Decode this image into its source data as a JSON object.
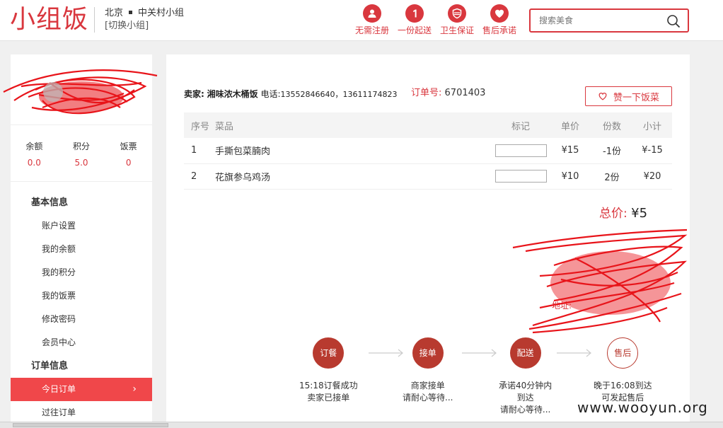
{
  "header": {
    "logo": "小组饭",
    "city": "北京",
    "group": "中关村小组",
    "switch_label": "[切换小组]",
    "features": [
      {
        "icon": "user-icon",
        "label": "无需注册"
      },
      {
        "icon": "number-one-icon",
        "label": "一份起送"
      },
      {
        "icon": "shield-icon",
        "label": "卫生保证"
      },
      {
        "icon": "heart-icon",
        "label": "售后承诺"
      }
    ],
    "search_placeholder": "搜索美食"
  },
  "sidebar": {
    "stats": [
      {
        "label": "余额",
        "value": "0.0"
      },
      {
        "label": "积分",
        "value": "5.0"
      },
      {
        "label": "饭票",
        "value": "0"
      }
    ],
    "basic_info_head": "基本信息",
    "basic_items": [
      "账户设置",
      "我的余额",
      "我的积分",
      "我的饭票",
      "修改密码",
      "会员中心"
    ],
    "order_info_head": "订单信息",
    "order_items": [
      "今日订单",
      "过往订单"
    ],
    "active_chevron": "›"
  },
  "order": {
    "seller_label": "卖家:",
    "seller_name": "湘味浓木桶饭",
    "phone_label": "电话:",
    "phones": "13552846640，13611174823",
    "order_no_label": "订单号:",
    "order_no": "6701403",
    "like_button": "赞一下饭菜",
    "columns": [
      "序号",
      "菜品",
      "标记",
      "单价",
      "份数",
      "小计"
    ],
    "rows": [
      {
        "no": "1",
        "name": "手撕包菜腩肉",
        "price": "¥15",
        "qty": "-1份",
        "subtotal": "¥-15"
      },
      {
        "no": "2",
        "name": "花旗参乌鸡汤",
        "price": "¥10",
        "qty": "2份",
        "subtotal": "¥20"
      }
    ],
    "total_label": "总价:",
    "total_value": "¥5",
    "address_label": "地址:"
  },
  "progress": [
    {
      "label": "订餐",
      "desc": [
        "15:18订餐成功",
        "卖家已接单"
      ]
    },
    {
      "label": "接单",
      "desc": [
        "商家接单",
        "请耐心等待..."
      ]
    },
    {
      "label": "配送",
      "desc": [
        "承诺40分钟内",
        "到达",
        "请耐心等待..."
      ]
    },
    {
      "label": "售后",
      "desc": [
        "晚于16:08到达",
        "可发起售后"
      ]
    }
  ],
  "watermark": "www.wooyun.org",
  "colors": {
    "brand": "#d9373e",
    "active": "#f0474a",
    "step": "#b83a2f"
  }
}
